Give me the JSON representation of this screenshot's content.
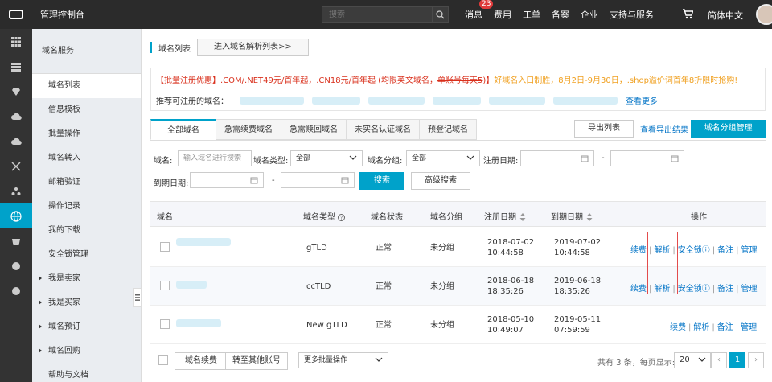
{
  "topbar": {
    "console_title": "管理控制台",
    "search_placeholder": "搜索",
    "nav": [
      {
        "label": "消息",
        "badge": "23"
      },
      {
        "label": "费用"
      },
      {
        "label": "工单"
      },
      {
        "label": "备案"
      },
      {
        "label": "企业"
      },
      {
        "label": "支持与服务"
      }
    ],
    "lang": "简体中文"
  },
  "sidebar": {
    "title": "域名服务",
    "items": [
      {
        "label": "域名列表",
        "active": true
      },
      {
        "label": "信息模板"
      },
      {
        "label": "批量操作"
      },
      {
        "label": "域名转入"
      },
      {
        "label": "邮箱验证"
      },
      {
        "label": "操作记录"
      },
      {
        "label": "我的下载"
      },
      {
        "label": "安全锁管理"
      }
    ],
    "groups": [
      "我是卖家",
      "我是买家",
      "域名预订",
      "域名回购",
      "帮助与文档"
    ]
  },
  "header": {
    "title": "域名列表",
    "dns_button": "进入域名解析列表>>"
  },
  "promo": {
    "part1": "【批量注册优惠】.COM/.NET49元/首年起，.CN18元/首年起 (均限英文域名，",
    "struck": "单账号每天5",
    "part2": ")】",
    "part3": "好域名入口制胜，8月2日-9月30日，.shop溢价词首年8折限时抢购!",
    "recommend_label": "推荐可注册的域名：",
    "more_link": "查看更多"
  },
  "tabs": [
    "全部域名",
    "急需续费域名",
    "急需赎回域名",
    "未实名认证域名",
    "预登记域名"
  ],
  "toolbar": {
    "export": "导出列表",
    "export_results": "查看导出结果",
    "group_manage": "域名分组管理"
  },
  "filters": {
    "domain_label": "域名:",
    "domain_placeholder": "输入域名进行搜索",
    "type_label": "域名类型:",
    "type_value": "全部",
    "group_label": "域名分组:",
    "group_value": "全部",
    "reg_date_label": "注册日期:",
    "dash": "-",
    "exp_date_label": "到期日期:",
    "search": "搜索",
    "advanced": "高级搜索"
  },
  "table": {
    "headers": {
      "domain": "域名",
      "type": "域名类型",
      "status": "域名状态",
      "group": "域名分组",
      "reg_date": "注册日期",
      "exp_date": "到期日期",
      "ops": "操作"
    },
    "rows": [
      {
        "type": "gTLD",
        "status": "正常",
        "group": "未分组",
        "reg_date": "2018-07-02",
        "reg_time": "10:44:58",
        "exp_date": "2019-07-02",
        "exp_time": "10:44:58"
      },
      {
        "type": "ccTLD",
        "status": "正常",
        "group": "未分组",
        "reg_date": "2018-06-18",
        "reg_time": "18:35:26",
        "exp_date": "2019-06-18",
        "exp_time": "18:35:26"
      },
      {
        "type": "New gTLD",
        "status": "正常",
        "group": "未分组",
        "reg_date": "2018-05-10",
        "reg_time": "10:49:07",
        "exp_date": "2019-05-11",
        "exp_time": "07:59:59"
      }
    ],
    "ops": {
      "renew": "续费",
      "resolve": "解析",
      "lock": "安全锁",
      "note": "备注",
      "manage": "管理",
      "sep": "|"
    }
  },
  "footer": {
    "batch_renew": "域名续费",
    "transfer": "转至其他账号",
    "more_batch": "更多批量操作",
    "summary": "共有 3 条，每页显示:",
    "page_size": "20",
    "prev": "‹",
    "current_page": "1",
    "next": "›"
  },
  "colors": {
    "accent": "#00a2ca",
    "link": "#0073c6",
    "promo_red": "#d9301c",
    "promo_orange": "#f0a020",
    "topbar": "#2b2b2b"
  }
}
